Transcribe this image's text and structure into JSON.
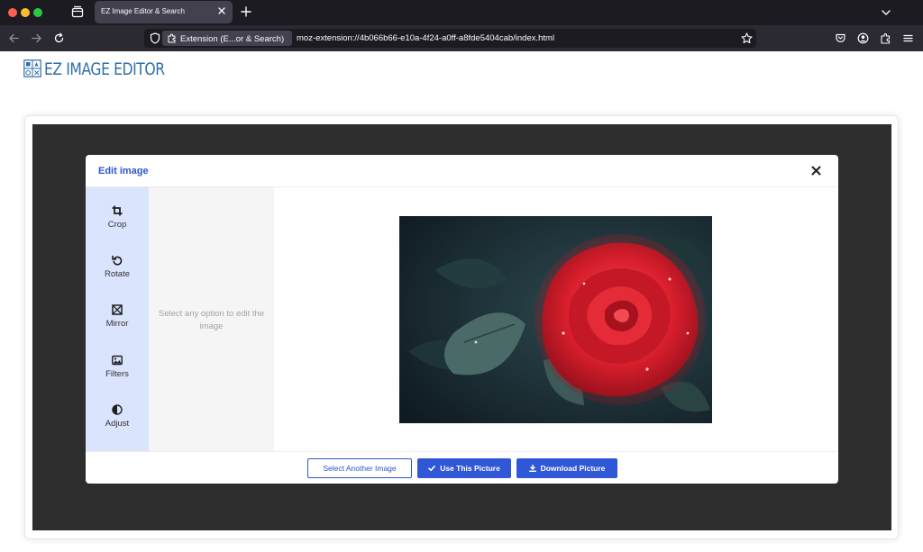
{
  "browser": {
    "tab_title": "EZ Image Editor & Search",
    "extension_label": "Extension (E...or & Search)",
    "url": "moz-extension://4b066b66-e10a-4f24-a0ff-a8fde5404cab/index.html"
  },
  "app": {
    "logo_text": "EZ IMAGE EDITOR",
    "brand_color": "#2f6ea8"
  },
  "modal": {
    "title": "Edit image",
    "accent_color": "#2b57c9",
    "tools": [
      {
        "label": "Crop",
        "icon": "crop-icon"
      },
      {
        "label": "Rotate",
        "icon": "rotate-icon"
      },
      {
        "label": "Mirror",
        "icon": "mirror-icon"
      },
      {
        "label": "Filters",
        "icon": "image-icon"
      },
      {
        "label": "Adjust",
        "icon": "contrast-icon"
      }
    ],
    "options_hint": "Select any option to edit the image",
    "buttons": {
      "select_another": "Select Another Image",
      "use_picture": "Use This Picture",
      "download": "Download Picture"
    }
  }
}
